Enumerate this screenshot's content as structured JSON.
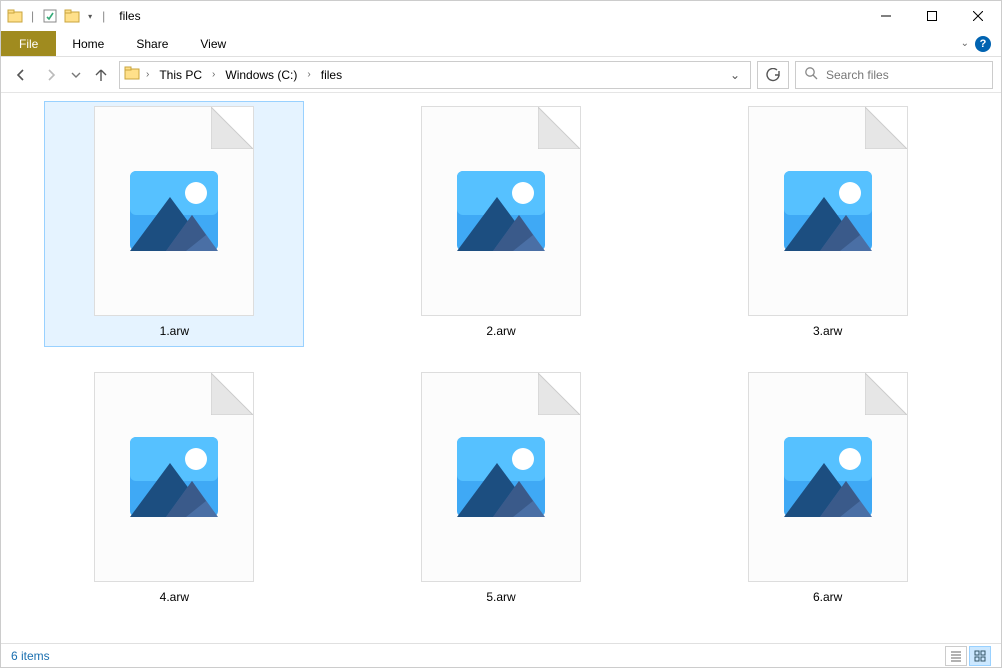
{
  "title": "files",
  "ribbon": {
    "file": "File",
    "home": "Home",
    "share": "Share",
    "view": "View",
    "help": "?"
  },
  "breadcrumb": {
    "segments": [
      "This PC",
      "Windows (C:)",
      "files"
    ]
  },
  "search": {
    "placeholder": "Search files"
  },
  "files": [
    {
      "name": "1.arw",
      "selected": true
    },
    {
      "name": "2.arw",
      "selected": false
    },
    {
      "name": "3.arw",
      "selected": false
    },
    {
      "name": "4.arw",
      "selected": false
    },
    {
      "name": "5.arw",
      "selected": false
    },
    {
      "name": "6.arw",
      "selected": false
    }
  ],
  "status": {
    "item_count": "6 items"
  }
}
